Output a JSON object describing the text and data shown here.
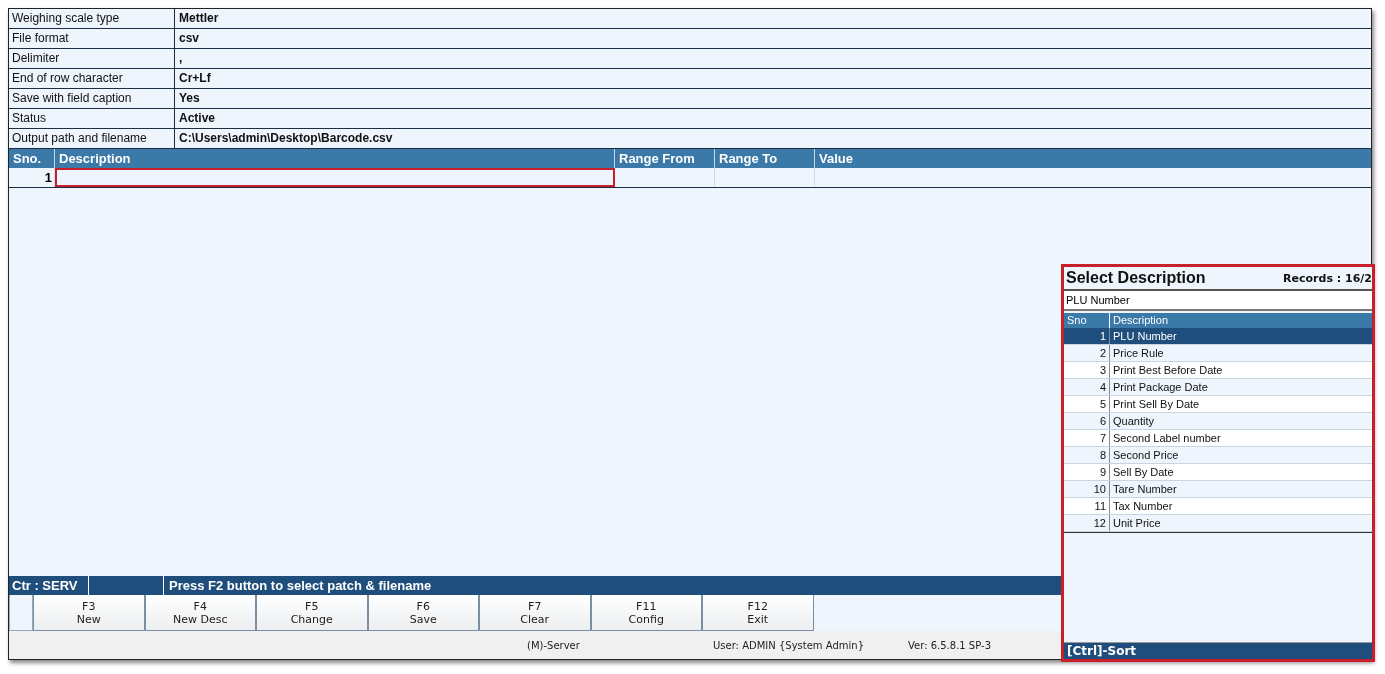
{
  "properties": [
    {
      "label": "Weighing scale type",
      "value": "Mettler"
    },
    {
      "label": "File format",
      "value": "csv"
    },
    {
      "label": "Delimiter",
      "value": ","
    },
    {
      "label": "End of row character",
      "value": "Cr+Lf"
    },
    {
      "label": "Save with field caption",
      "value": "Yes"
    },
    {
      "label": "Status",
      "value": "Active"
    },
    {
      "label": "Output path and filename",
      "value": "C:\\Users\\admin\\Desktop\\Barcode.csv"
    }
  ],
  "grid": {
    "columns": [
      "Sno.",
      "Description",
      "Range From",
      "Range To",
      "Value"
    ],
    "rows": [
      {
        "sno": "1",
        "highlighted": true
      }
    ]
  },
  "status_bar": {
    "counter": "Ctr : SERV",
    "message": "Press F2 button to select patch & filename"
  },
  "function_keys": [
    {
      "key": "F3",
      "label": "New"
    },
    {
      "key": "F4",
      "label": "New Desc"
    },
    {
      "key": "F5",
      "label": "Change"
    },
    {
      "key": "F6",
      "label": "Save"
    },
    {
      "key": "F7",
      "label": "Clear"
    },
    {
      "key": "F11",
      "label": "Config"
    },
    {
      "key": "F12",
      "label": "Exit"
    }
  ],
  "footer": {
    "server": "(M)-Server",
    "user": "User: ADMIN {System Admin}",
    "version": "Ver: 6.5.8.1 SP-3"
  },
  "popup": {
    "title": "Select Description",
    "records": "Records : 16/2",
    "search_value": "PLU Number",
    "highlighted": true,
    "columns": [
      "Sno",
      "Description"
    ],
    "rows": [
      {
        "sno": "1",
        "description": "PLU Number",
        "selected": true
      },
      {
        "sno": "2",
        "description": "Price Rule",
        "selected": false
      },
      {
        "sno": "3",
        "description": "Print Best Before Date",
        "selected": false
      },
      {
        "sno": "4",
        "description": "Print Package Date",
        "selected": false
      },
      {
        "sno": "5",
        "description": "Print Sell By Date",
        "selected": false
      },
      {
        "sno": "6",
        "description": "Quantity",
        "selected": false
      },
      {
        "sno": "7",
        "description": "Second Label number",
        "selected": false
      },
      {
        "sno": "8",
        "description": "Second Price",
        "selected": false
      },
      {
        "sno": "9",
        "description": "Sell By Date",
        "selected": false
      },
      {
        "sno": "10",
        "description": "Tare Number",
        "selected": false
      },
      {
        "sno": "11",
        "description": "Tax Number",
        "selected": false
      },
      {
        "sno": "12",
        "description": "Unit Price",
        "selected": false
      }
    ],
    "footer": "[Ctrl]-Sort"
  }
}
